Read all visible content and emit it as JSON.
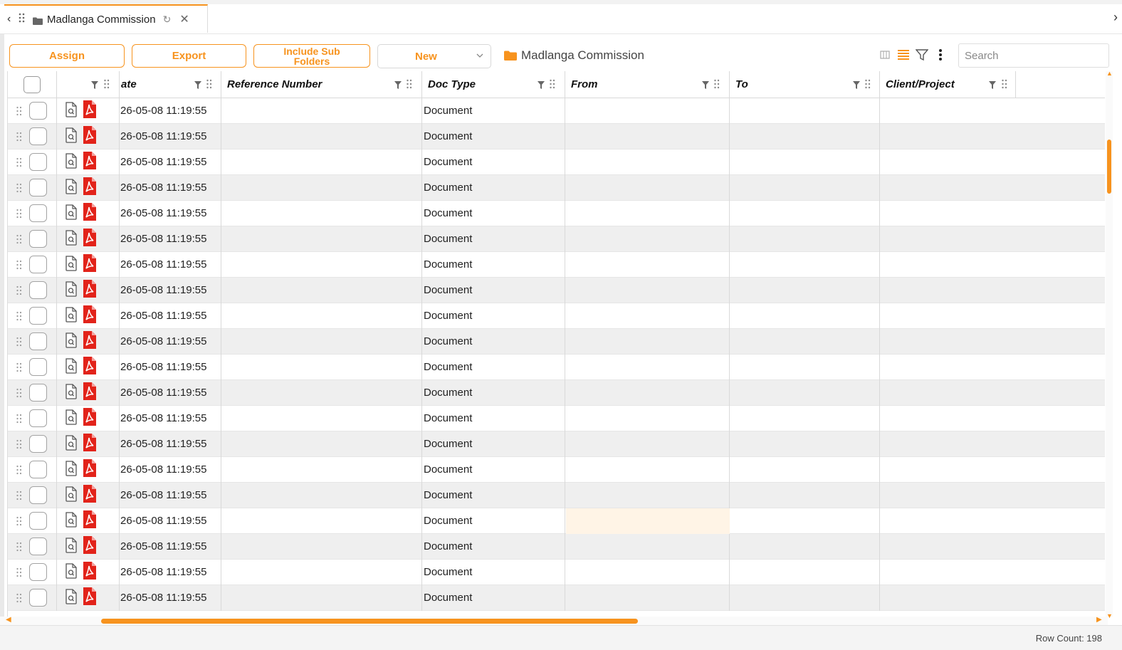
{
  "tab": {
    "title": "Madlanga Commission",
    "back_glyph": "‹",
    "next_glyph": "›",
    "refresh_glyph": "↻",
    "close_glyph": "✕"
  },
  "toolbar": {
    "assign_label": "Assign",
    "export_label": "Export",
    "include_sub_line1": "Include Sub",
    "include_sub_line2": "Folders",
    "new_label": "New",
    "breadcrumb": "Madlanga Commission",
    "search_placeholder": "Search"
  },
  "columns": {
    "date": "ate",
    "reference": "Reference Number",
    "doctype": "Doc Type",
    "from": "From",
    "to": "To",
    "client": "Client/Project"
  },
  "rows": [
    {
      "date": "26-05-08 11:19:55",
      "doc_type": "Document"
    },
    {
      "date": "26-05-08 11:19:55",
      "doc_type": "Document"
    },
    {
      "date": "26-05-08 11:19:55",
      "doc_type": "Document"
    },
    {
      "date": "26-05-08 11:19:55",
      "doc_type": "Document"
    },
    {
      "date": "26-05-08 11:19:55",
      "doc_type": "Document"
    },
    {
      "date": "26-05-08 11:19:55",
      "doc_type": "Document"
    },
    {
      "date": "26-05-08 11:19:55",
      "doc_type": "Document"
    },
    {
      "date": "26-05-08 11:19:55",
      "doc_type": "Document"
    },
    {
      "date": "26-05-08 11:19:55",
      "doc_type": "Document"
    },
    {
      "date": "26-05-08 11:19:55",
      "doc_type": "Document"
    },
    {
      "date": "26-05-08 11:19:55",
      "doc_type": "Document"
    },
    {
      "date": "26-05-08 11:19:55",
      "doc_type": "Document"
    },
    {
      "date": "26-05-08 11:19:55",
      "doc_type": "Document"
    },
    {
      "date": "26-05-08 11:19:55",
      "doc_type": "Document"
    },
    {
      "date": "26-05-08 11:19:55",
      "doc_type": "Document"
    },
    {
      "date": "26-05-08 11:19:55",
      "doc_type": "Document"
    },
    {
      "date": "26-05-08 11:19:55",
      "doc_type": "Document"
    },
    {
      "date": "26-05-08 11:19:55",
      "doc_type": "Document"
    },
    {
      "date": "26-05-08 11:19:55",
      "doc_type": "Document"
    },
    {
      "date": "26-05-08 11:19:55",
      "doc_type": "Document"
    }
  ],
  "footer": {
    "row_count": "Row Count: 198"
  },
  "colors": {
    "accent": "#f7931e",
    "pdf_red": "#e2231a",
    "row_alt": "#efefef",
    "highlight": "#fff4e6"
  },
  "icons": [
    "back-icon",
    "grip-icon",
    "folder-icon",
    "refresh-icon",
    "close-icon",
    "next-icon",
    "column-chooser-icon",
    "list-view-icon",
    "filter-icon",
    "more-vertical-icon",
    "preview-icon",
    "pdf-icon"
  ]
}
